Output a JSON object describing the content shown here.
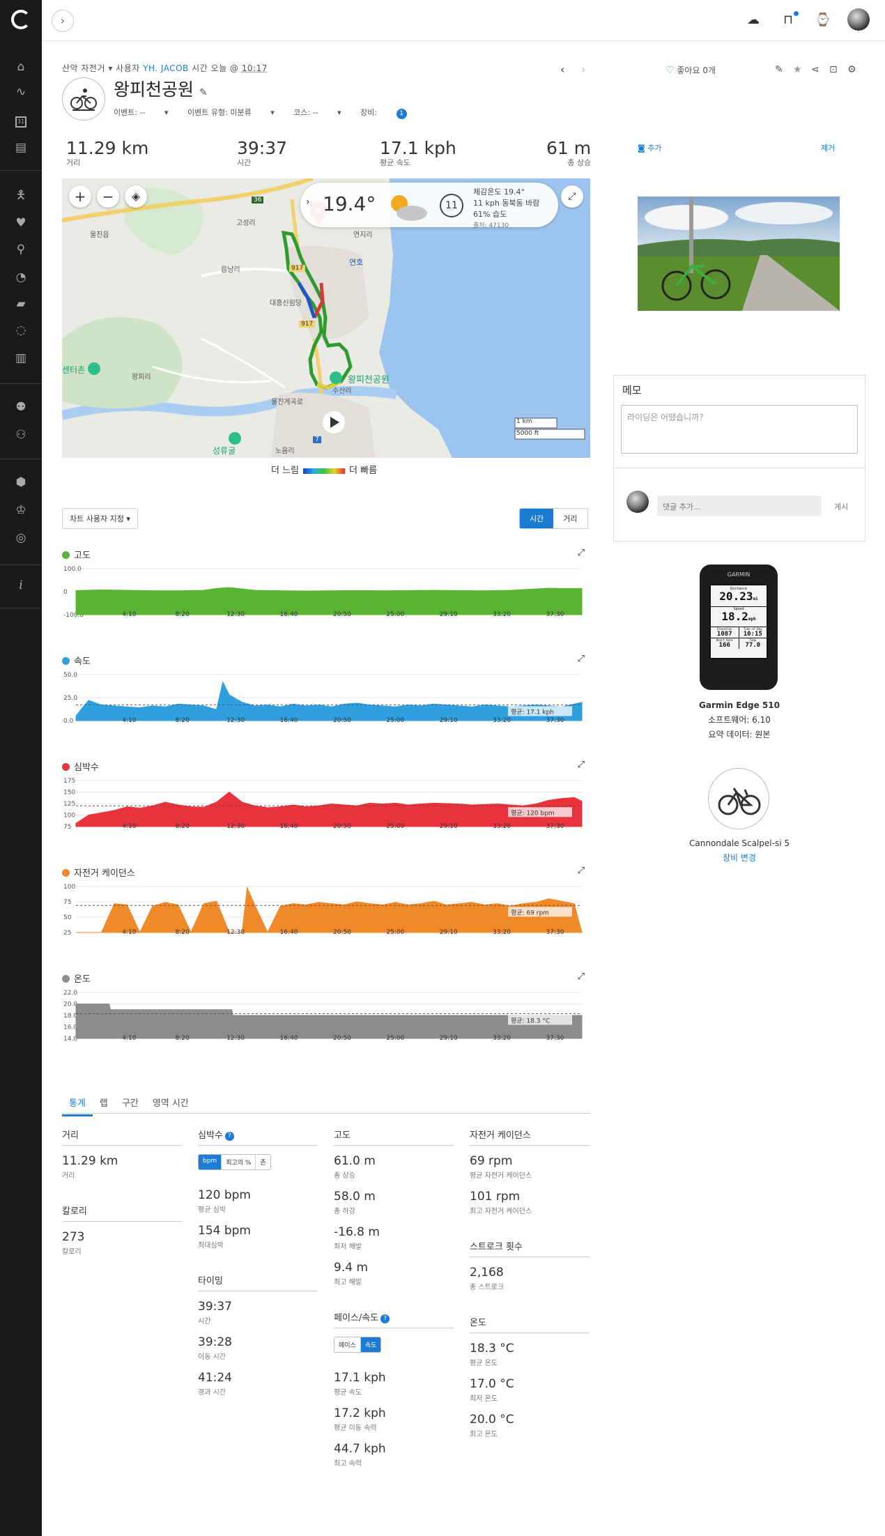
{
  "sidebar": {
    "icons": [
      "home-icon",
      "activity-icon",
      "calendar-icon",
      "reports-icon",
      "training-icon",
      "health-icon",
      "sport-icon",
      "timer-icon",
      "shoe-icon",
      "insight-icon",
      "stats-icon",
      "connections-icon",
      "groups-icon",
      "badges-icon",
      "challenges-icon",
      "courses-icon",
      "info-icon"
    ],
    "calendar_day": "31"
  },
  "activity": {
    "type": "산악 자전거",
    "by_label": "사용자",
    "user": "YH. JACOB",
    "time_label": "시간",
    "date": "오늘 @",
    "time": "10:17",
    "title": "왕피천공원",
    "event_label": "이벤트: --",
    "event_type_label": "이벤트 유형: 미분류",
    "course_label": "코스: --",
    "gear_label": "장비:",
    "gear_count": "1"
  },
  "header_actions": {
    "like_label": "좋아요 0개"
  },
  "summary": [
    {
      "value": "11.29 km",
      "label": "거리"
    },
    {
      "value": "39:37",
      "label": "시간"
    },
    {
      "value": "17.1 kph",
      "label": "평균 속도"
    },
    {
      "value": "61 m",
      "label": "총 상승"
    }
  ],
  "map": {
    "weather_temp": "19.4°",
    "wind_speed": "11",
    "feels_like": "체감온도 19.4°",
    "wind": "11 kph 동북동 바람",
    "humidity": "61% 습도",
    "source": "출처: 47130",
    "park_label": "왕피천공원",
    "place_labels": [
      "울진읍",
      "고성리",
      "읍남리",
      "대흥신림당",
      "왕피리",
      "수산리",
      "울진게곡로",
      "노음리",
      "성류굴",
      "센터촌",
      "연호",
      "연지리"
    ],
    "road_labels": [
      "36",
      "917",
      "917",
      "7"
    ],
    "scale_km": "1 km",
    "scale_ft": "5000 ft",
    "legend_slow": "더 느림",
    "legend_fast": "더 빠름"
  },
  "chart_controls": {
    "customize_label": "차트 사용자 지정",
    "time_label": "시간",
    "distance_label": "거리"
  },
  "chart_data": [
    {
      "type": "area",
      "title": "고도",
      "color": "#5ab434",
      "x_ticks": [
        "4:10",
        "8:20",
        "12:30",
        "16:40",
        "20:50",
        "25:00",
        "29:10",
        "33:20",
        "37:30"
      ],
      "y_ticks": [
        "100.0",
        "0",
        "-100.0"
      ],
      "ylim": [
        -100,
        100
      ],
      "x": [
        0,
        2,
        4,
        6,
        8,
        10,
        11,
        12,
        13,
        14,
        16,
        18,
        20,
        22,
        24,
        26,
        28,
        30,
        32,
        34,
        36,
        37,
        38,
        39.6
      ],
      "values": [
        5,
        8,
        6,
        4,
        4,
        6,
        14,
        18,
        12,
        6,
        4,
        3,
        4,
        5,
        4,
        5,
        6,
        5,
        4,
        6,
        12,
        15,
        14,
        14
      ]
    },
    {
      "type": "area",
      "title": "속도",
      "color": "#2f9fe0",
      "x_ticks": [
        "4:10",
        "8:20",
        "12:30",
        "16:40",
        "20:50",
        "25:00",
        "29:10",
        "33:20",
        "37:30"
      ],
      "y_ticks": [
        "50.0",
        "25.0",
        "0.0"
      ],
      "ylim": [
        0,
        50
      ],
      "avg_value": 17.1,
      "avg_label": "평균: 17.1 kph",
      "x": [
        0,
        0.5,
        1,
        2,
        3,
        4,
        5,
        6,
        7,
        8,
        9,
        10,
        11,
        11.5,
        12,
        13,
        14,
        15,
        16,
        17,
        18,
        19,
        20,
        21,
        22,
        23,
        24,
        25,
        26,
        27,
        28,
        29,
        30,
        31,
        32,
        33,
        34,
        35,
        36,
        37,
        38,
        39,
        39.6
      ],
      "values": [
        5,
        14,
        22,
        17,
        16,
        15,
        14,
        16,
        15,
        18,
        17,
        16,
        12,
        42,
        28,
        20,
        16,
        17,
        15,
        18,
        16,
        17,
        15,
        18,
        19,
        17,
        16,
        15,
        17,
        16,
        18,
        17,
        16,
        15,
        17,
        16,
        15,
        16,
        17,
        16,
        15,
        18,
        20
      ]
    },
    {
      "type": "area",
      "title": "심박수",
      "color": "#e8323c",
      "x_ticks": [
        "4:10",
        "8:20",
        "12:30",
        "16:40",
        "20:50",
        "25:00",
        "29:10",
        "33:20",
        "37:30"
      ],
      "y_ticks": [
        "175",
        "150",
        "125",
        "100",
        "75"
      ],
      "ylim": [
        75,
        175
      ],
      "avg_value": 120,
      "avg_label": "평균: 120 bpm",
      "x": [
        0,
        1,
        2,
        3,
        4,
        5,
        6,
        7,
        8,
        9,
        10,
        11,
        12,
        13,
        14,
        15,
        16,
        17,
        18,
        19,
        20,
        21,
        22,
        23,
        24,
        25,
        26,
        27,
        28,
        29,
        30,
        31,
        32,
        33,
        34,
        35,
        36,
        37,
        38,
        39,
        39.6
      ],
      "values": [
        82,
        100,
        105,
        110,
        118,
        115,
        120,
        128,
        122,
        118,
        117,
        128,
        150,
        128,
        120,
        116,
        118,
        122,
        118,
        120,
        124,
        122,
        120,
        126,
        124,
        126,
        122,
        124,
        126,
        125,
        124,
        122,
        123,
        124,
        122,
        120,
        124,
        132,
        136,
        138,
        130
      ]
    },
    {
      "type": "area",
      "title": "자전거 케이던스",
      "color": "#f0892a",
      "x_ticks": [
        "4:10",
        "8:20",
        "12:30",
        "16:40",
        "20:50",
        "25:00",
        "29:10",
        "33:20",
        "37:30"
      ],
      "y_ticks": [
        "100",
        "75",
        "50",
        "25"
      ],
      "ylim": [
        25,
        100
      ],
      "avg_value": 69,
      "avg_label": "평균: 69 rpm",
      "x": [
        0,
        2,
        3,
        4,
        5,
        6,
        7,
        8,
        9,
        10,
        11,
        12,
        13,
        13.4,
        14,
        15,
        16,
        17,
        18,
        19,
        20,
        21,
        22,
        23,
        24,
        25,
        26,
        27,
        28,
        29,
        30,
        31,
        32,
        33,
        34,
        35,
        36,
        37,
        38,
        39,
        39.6
      ],
      "values": [
        25,
        25,
        72,
        70,
        25,
        68,
        74,
        70,
        25,
        72,
        76,
        25,
        25,
        98,
        70,
        25,
        68,
        72,
        70,
        74,
        72,
        70,
        75,
        72,
        70,
        74,
        70,
        72,
        76,
        70,
        72,
        74,
        70,
        72,
        68,
        72,
        74,
        80,
        76,
        72,
        25
      ]
    },
    {
      "type": "area",
      "title": "온도",
      "color": "#8c8c8c",
      "x_ticks": [
        "4:10",
        "8:20",
        "12:30",
        "16:40",
        "20:50",
        "25:00",
        "29:10",
        "33:20",
        "37:30"
      ],
      "y_ticks": [
        "22.0",
        "20.0",
        "18.0",
        "16.0",
        "14.0"
      ],
      "ylim": [
        14,
        22
      ],
      "avg_value": 18.3,
      "avg_label": "평균: 18.3 °C",
      "x": [
        0,
        2.6,
        2.7,
        12.2,
        12.3,
        39.6
      ],
      "values": [
        20.0,
        20.0,
        19.0,
        19.0,
        18.0,
        18.0
      ]
    }
  ],
  "tabs": [
    "통계",
    "랩",
    "구간",
    "영역 시간"
  ],
  "stats": {
    "distance": {
      "header": "거리",
      "value": "11.29 km",
      "label": "거리"
    },
    "calories": {
      "header": "칼로리",
      "value": "273",
      "label": "칼로리"
    },
    "heart_rate": {
      "header": "심박수",
      "toggle": [
        "bpm",
        "최고의 %",
        "존"
      ],
      "items": [
        {
          "value": "120 bpm",
          "label": "평균 심박"
        },
        {
          "value": "154 bpm",
          "label": "최대심박"
        }
      ]
    },
    "timing": {
      "header": "타이밍",
      "items": [
        {
          "value": "39:37",
          "label": "시간"
        },
        {
          "value": "39:28",
          "label": "이동 시간"
        },
        {
          "value": "41:24",
          "label": "경과 시간"
        }
      ]
    },
    "elevation": {
      "header": "고도",
      "items": [
        {
          "value": "61.0 m",
          "label": "총 상승"
        },
        {
          "value": "58.0 m",
          "label": "총 하강"
        },
        {
          "value": "-16.8 m",
          "label": "최저 해발"
        },
        {
          "value": "9.4 m",
          "label": "최고 해발"
        }
      ]
    },
    "pace_speed": {
      "header": "페이스/속도",
      "toggle": [
        "페이스",
        "속도"
      ],
      "items": [
        {
          "value": "17.1 kph",
          "label": "평균 속도"
        },
        {
          "value": "17.2 kph",
          "label": "평균 이동 속력"
        },
        {
          "value": "44.7 kph",
          "label": "최고 속력"
        }
      ]
    },
    "cadence": {
      "header": "자전거 케이던스",
      "items": [
        {
          "value": "69 rpm",
          "label": "평균 자전거 케이던스"
        },
        {
          "value": "101 rpm",
          "label": "최고 자전거 케이던스"
        }
      ]
    },
    "strokes": {
      "header": "스트로크 횟수",
      "items": [
        {
          "value": "2,168",
          "label": "총 스트로크"
        }
      ]
    },
    "temperature": {
      "header": "온도",
      "items": [
        {
          "value": "18.3 °C",
          "label": "평균 온도"
        },
        {
          "value": "17.0 °C",
          "label": "최저 온도"
        },
        {
          "value": "20.0 °C",
          "label": "최고 온도"
        }
      ]
    }
  },
  "right_panel": {
    "add_photo": "추가",
    "remove": "제거",
    "memo_title": "메모",
    "memo_placeholder": "라이딩은 어땠습니까?",
    "comment_placeholder": "댓글 추가...",
    "post_label": "게시",
    "device_screen": {
      "brand": "GARMIN",
      "distance_label": "Distance",
      "distance": "20.23",
      "distance_unit": "mi",
      "speed_label": "Speed",
      "speed": "18.2",
      "speed_unit": "mph",
      "elevation_label": "Elevation",
      "elevation": "1087",
      "time_label": "Time of Day",
      "time": "10:15",
      "hr_label": "Heart Rate",
      "hr": "166",
      "temp_label": "Temp",
      "temp": "77.0"
    },
    "device_name": "Garmin Edge 510",
    "software": "소프트웨어: 6.10",
    "summary_data": "요약 데이터: 원본",
    "gear_name": "Cannondale Scalpel-si 5",
    "change_gear": "장비 변경"
  }
}
